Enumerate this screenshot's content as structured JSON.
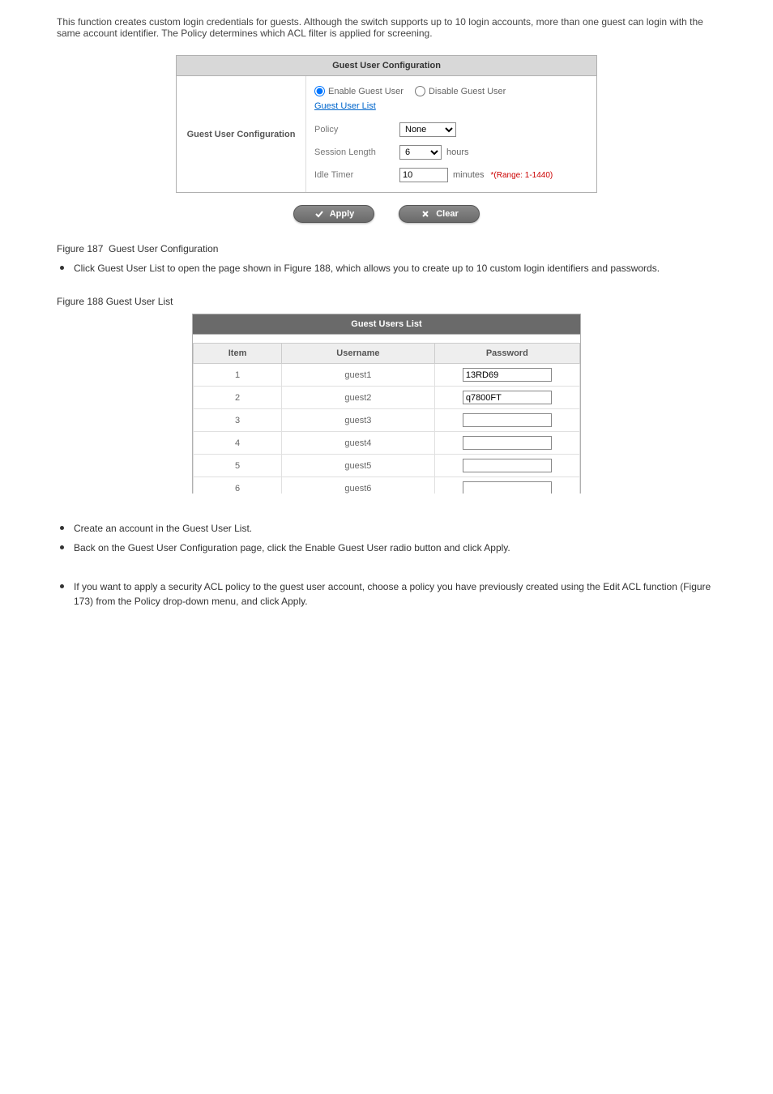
{
  "intro": "This function creates custom login credentials for guests. Although the switch supports up to 10 login accounts, more than one guest can login with the same account identifier. The Policy determines which ACL filter is applied for screening.",
  "config": {
    "title": "Guest User Configuration",
    "sectionLabel": "Guest User Configuration",
    "radioEnable": "Enable Guest User",
    "radioDisable": "Disable Guest User",
    "guestListLink": "Guest User List",
    "policyLabel": "Policy",
    "policyValue": "None",
    "sessionLabel": "Session Length",
    "sessionValue": "6",
    "sessionUnit": "hours",
    "idleLabel": "Idle Timer",
    "idleValue": "10",
    "idleUnit": "minutes",
    "idleHint": "*(Range: 1-1440)"
  },
  "buttons": {
    "apply": "Apply",
    "clear": "Clear"
  },
  "bullet1": "Click Guest User List to open the page shown in Figure 188, which allows you to create up to 10 custom login identifiers and passwords.",
  "figureCaption": "Figure 188  Guest User List",
  "userList": {
    "title": "Guest Users List",
    "colItem": "Item",
    "colUser": "Username",
    "colPass": "Password",
    "rows": [
      {
        "item": "1",
        "user": "guest1",
        "pass": "13RD69"
      },
      {
        "item": "2",
        "user": "guest2",
        "pass": "q7800FT"
      },
      {
        "item": "3",
        "user": "guest3",
        "pass": ""
      },
      {
        "item": "4",
        "user": "guest4",
        "pass": ""
      },
      {
        "item": "5",
        "user": "guest5",
        "pass": ""
      },
      {
        "item": "6",
        "user": "guest6",
        "pass": ""
      }
    ]
  },
  "bullet2": "Create an account in the Guest User List.",
  "bullet3": "Back on the Guest User Configuration page, click the Enable Guest User radio button and click Apply.",
  "bullet4": "If you want to apply a security ACL policy to the guest user account, choose a policy you have previously created using the Edit ACL function (Figure 173) from the Policy drop-down menu, and click Apply."
}
